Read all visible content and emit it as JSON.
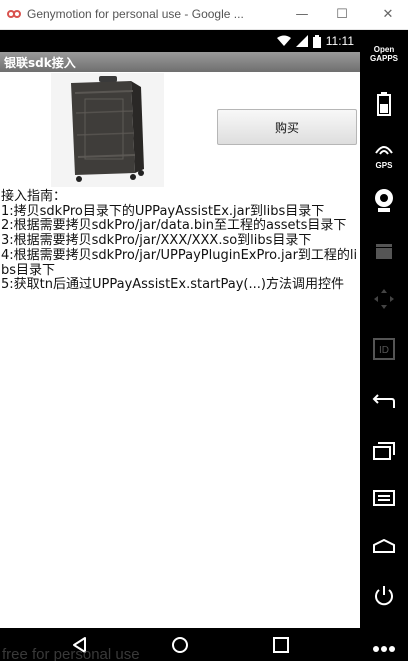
{
  "window": {
    "title": "Genymotion for personal use - Google ...",
    "minimize_glyph": "—",
    "maximize_glyph": "☐",
    "close_glyph": "✕"
  },
  "statusbar": {
    "time": "11:11"
  },
  "actionbar": {
    "title": "银联sdk接入"
  },
  "product": {
    "image": "suitcase-image"
  },
  "buy_button": {
    "label": "购买"
  },
  "guide": {
    "heading": "接入指南：",
    "steps": [
      "1:拷贝sdkPro目录下的UPPayAssistEx.jar到libs目录下",
      "2:根据需要拷贝sdkPro/jar/data.bin至工程的assets目录下",
      "3:根据需要拷贝sdkPro/jar/XXX/XXX.so到libs目录下",
      "4:根据需要拷贝sdkPro/jar/UPPayPluginExPro.jar到工程的libs目录下",
      "5:获取tn后通过UPPayAssistEx.startPay(...)方法调用控件"
    ]
  },
  "sidepanel": {
    "open_gapps_line1": "Open",
    "open_gapps_line2": "GAPPS",
    "gps_label": "GPS",
    "id_label": "ID"
  },
  "watermark": "free for personal use"
}
